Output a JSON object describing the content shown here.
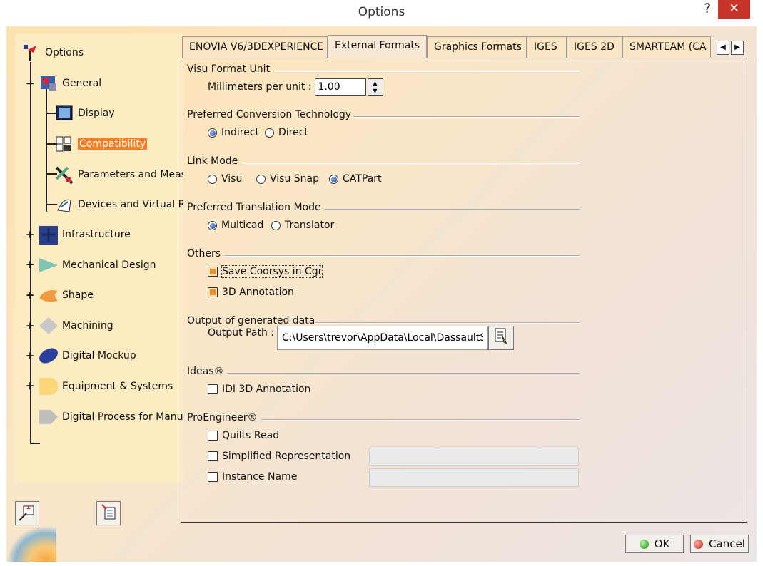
{
  "window": {
    "title": "Options",
    "help_label": "?",
    "close_label": "✕"
  },
  "tree": {
    "items": [
      {
        "label": "Options",
        "icon": "options-icon"
      },
      {
        "label": "General",
        "icon": "general-icon",
        "expander": "−"
      },
      {
        "label": "Display",
        "icon": "display-icon"
      },
      {
        "label": "Compatibility",
        "icon": "compatibility-icon",
        "selected": true
      },
      {
        "label": "Parameters and Measu",
        "icon": "parameters-icon"
      },
      {
        "label": "Devices and Virtual Rea",
        "icon": "devices-icon"
      },
      {
        "label": "Infrastructure",
        "icon": "infrastructure-icon",
        "expander": "+"
      },
      {
        "label": "Mechanical Design",
        "icon": "mechanical-design-icon",
        "expander": "+"
      },
      {
        "label": "Shape",
        "icon": "shape-icon",
        "expander": "+"
      },
      {
        "label": "Machining",
        "icon": "machining-icon",
        "expander": "+"
      },
      {
        "label": "Digital Mockup",
        "icon": "digital-mockup-icon",
        "expander": "+"
      },
      {
        "label": "Equipment & Systems",
        "icon": "equipment-icon",
        "expander": "+"
      },
      {
        "label": "Digital Process for Manufa",
        "icon": "digital-process-icon"
      }
    ]
  },
  "tabs": [
    {
      "label": "ENOVIA V6/3DEXPERIENCE"
    },
    {
      "label": "External Formats",
      "active": true
    },
    {
      "label": "Graphics Formats"
    },
    {
      "label": "IGES"
    },
    {
      "label": "IGES 2D"
    },
    {
      "label": "SMARTEAM (CA"
    }
  ],
  "tab_scroll": {
    "left": "◀",
    "right": "▶"
  },
  "sections": {
    "visu_format_unit": {
      "title": "Visu Format Unit",
      "mm_per_unit_label": "Millimeters per unit :",
      "mm_per_unit_value": "1.00"
    },
    "conversion": {
      "title": "Preferred Conversion Technology",
      "options": [
        {
          "label": "Indirect",
          "checked": true
        },
        {
          "label": "Direct",
          "checked": false
        }
      ]
    },
    "link_mode": {
      "title": "Link Mode",
      "options": [
        {
          "label": "Visu",
          "checked": false
        },
        {
          "label": "Visu Snap",
          "checked": false
        },
        {
          "label": "CATPart",
          "checked": true
        }
      ]
    },
    "translation": {
      "title": "Preferred Translation Mode",
      "options": [
        {
          "label": "Multicad",
          "checked": true
        },
        {
          "label": "Translator",
          "checked": false
        }
      ]
    },
    "others": {
      "title": "Others",
      "save_coorsys": {
        "label": "Save Coorsys in Cgr",
        "checked": true
      },
      "annotation_3d": {
        "label": "3D Annotation",
        "checked": true
      }
    },
    "output": {
      "title": "Output of generated data",
      "path_label": "Output Path :",
      "path_value": "C:\\Users\\trevor\\AppData\\Local\\DassaultSys"
    },
    "ideas": {
      "title": "Ideas®",
      "idi_3d": {
        "label": "IDI 3D Annotation",
        "checked": false
      }
    },
    "proengineer": {
      "title": "ProEngineer®",
      "quilts_read": {
        "label": "Quilts Read",
        "checked": false
      },
      "simplified": {
        "label": "Simplified Representation",
        "checked": false
      },
      "instance_name": {
        "label": "Instance Name",
        "checked": false
      }
    }
  },
  "buttons": {
    "ok": "OK",
    "cancel": "Cancel"
  },
  "colors": {
    "selection": "#f57f22",
    "close": "#c7352a"
  }
}
